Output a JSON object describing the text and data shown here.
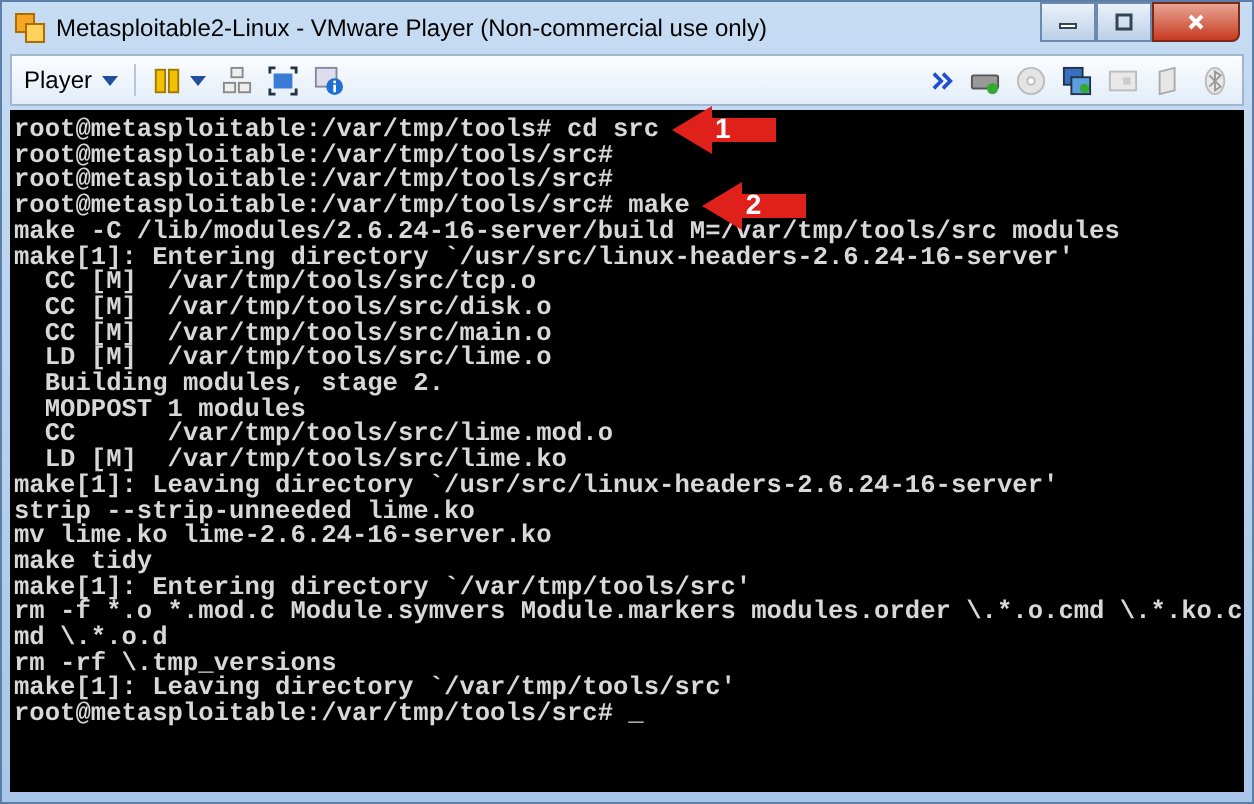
{
  "window": {
    "title": "Metasploitable2-Linux - VMware Player (Non-commercial use only)"
  },
  "toolbar": {
    "player_menu": "Player"
  },
  "terminal": {
    "lines": [
      {
        "text": "root@metasploitable:/var/tmp/tools# cd src",
        "marker": "1"
      },
      {
        "text": "root@metasploitable:/var/tmp/tools/src#"
      },
      {
        "text": "root@metasploitable:/var/tmp/tools/src#"
      },
      {
        "text": "root@metasploitable:/var/tmp/tools/src# make",
        "marker": "2"
      },
      {
        "text": "make -C /lib/modules/2.6.24-16-server/build M=/var/tmp/tools/src modules"
      },
      {
        "text": "make[1]: Entering directory `/usr/src/linux-headers-2.6.24-16-server'"
      },
      {
        "text": "  CC [M]  /var/tmp/tools/src/tcp.o"
      },
      {
        "text": "  CC [M]  /var/tmp/tools/src/disk.o"
      },
      {
        "text": "  CC [M]  /var/tmp/tools/src/main.o"
      },
      {
        "text": "  LD [M]  /var/tmp/tools/src/lime.o"
      },
      {
        "text": "  Building modules, stage 2."
      },
      {
        "text": "  MODPOST 1 modules"
      },
      {
        "text": "  CC      /var/tmp/tools/src/lime.mod.o"
      },
      {
        "text": "  LD [M]  /var/tmp/tools/src/lime.ko"
      },
      {
        "text": "make[1]: Leaving directory `/usr/src/linux-headers-2.6.24-16-server'"
      },
      {
        "text": "strip --strip-unneeded lime.ko"
      },
      {
        "text": "mv lime.ko lime-2.6.24-16-server.ko"
      },
      {
        "text": "make tidy"
      },
      {
        "text": "make[1]: Entering directory `/var/tmp/tools/src'"
      },
      {
        "text": "rm -f *.o *.mod.c Module.symvers Module.markers modules.order \\.*.o.cmd \\.*.ko.c"
      },
      {
        "text": "md \\.*.o.d"
      },
      {
        "text": "rm -rf \\.tmp_versions"
      },
      {
        "text": "make[1]: Leaving directory `/var/tmp/tools/src'"
      },
      {
        "text": "root@metasploitable:/var/tmp/tools/src# _"
      }
    ]
  }
}
